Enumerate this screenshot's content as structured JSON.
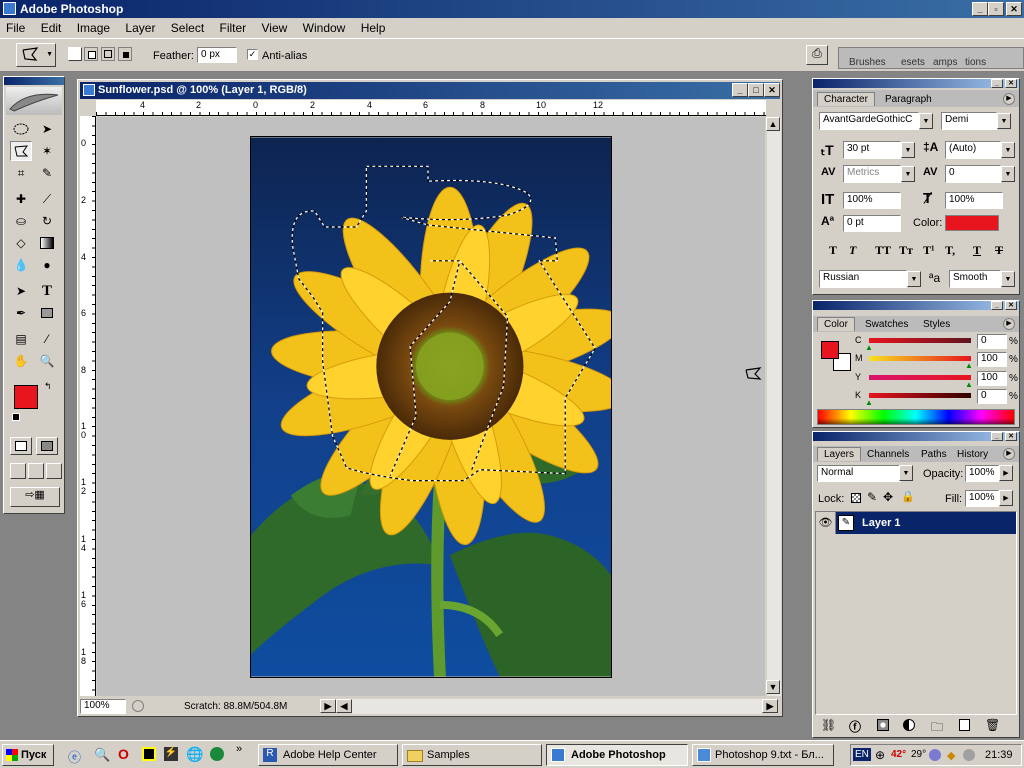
{
  "app": {
    "title": "Adobe Photoshop"
  },
  "menu": [
    "File",
    "Edit",
    "Image",
    "Layer",
    "Select",
    "Filter",
    "View",
    "Window",
    "Help"
  ],
  "options": {
    "feather_label": "Feather:",
    "feather_value": "0 px",
    "antialias_label": "Anti-alias",
    "well_tabs": [
      "Brushes",
      "esets",
      "amps",
      "tions"
    ]
  },
  "document": {
    "title": "Sunflower.psd @ 100% (Layer 1, RGB/8)",
    "zoom": "100%",
    "scratch": "Scratch: 88.8M/504.8M",
    "ruler_h": [
      "4",
      "2",
      "0",
      "2",
      "4",
      "6",
      "8",
      "10",
      "12"
    ],
    "ruler_v": [
      "0",
      "2",
      "4",
      "6",
      "8",
      "1 0",
      "1 2",
      "1 4",
      "1 6",
      "1 8"
    ]
  },
  "character": {
    "tabs": [
      "Character",
      "Paragraph"
    ],
    "font_family": "AvantGardeGothicC",
    "font_style": "Demi",
    "size": "30 pt",
    "leading": "(Auto)",
    "kerning": "Metrics",
    "tracking": "0",
    "vscale": "100%",
    "hscale": "100%",
    "baseline": "0 pt",
    "color_label": "Color:",
    "language": "Russian",
    "aa_label": "aa",
    "aa_mode": "Smooth",
    "style_buttons": [
      "T",
      "T",
      "TT",
      "Tт",
      "T¹",
      "T,",
      "T",
      "T"
    ]
  },
  "color": {
    "tabs": [
      "Color",
      "Swatches",
      "Styles"
    ],
    "channels": [
      {
        "label": "C",
        "value": "0"
      },
      {
        "label": "M",
        "value": "100"
      },
      {
        "label": "Y",
        "value": "100"
      },
      {
        "label": "K",
        "value": "0"
      }
    ],
    "percent": "%",
    "foreground": "#e8141e",
    "background": "#ffffff"
  },
  "layers": {
    "tabs": [
      "Layers",
      "Channels",
      "Paths",
      "History"
    ],
    "blend_mode": "Normal",
    "opacity_label": "Opacity:",
    "opacity": "100%",
    "lock_label": "Lock:",
    "fill_label": "Fill:",
    "fill": "100%",
    "items": [
      {
        "name": "Layer 1"
      }
    ]
  },
  "taskbar": {
    "start": "Пуск",
    "tasks": [
      "Adobe Help Center",
      "Samples",
      "Adobe Photoshop",
      "Photoshop 9.txt - Бл..."
    ],
    "lang": "EN",
    "temp": "42°",
    "temp2": "29°",
    "clock": "21:39"
  },
  "icons": {
    "tools": [
      "marquee",
      "move",
      "lasso",
      "magic-wand",
      "crop",
      "slice",
      "healing",
      "brush",
      "stamp",
      "history-brush",
      "eraser",
      "gradient",
      "blur",
      "dodge",
      "path-select",
      "type",
      "pen",
      "shape",
      "notes",
      "eyedropper",
      "hand",
      "zoom"
    ]
  }
}
